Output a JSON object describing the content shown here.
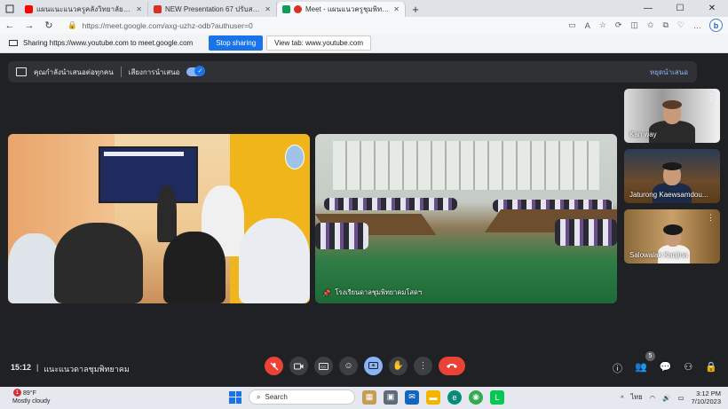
{
  "browser": {
    "tabs": [
      {
        "title": "แผนแนะแนวครูคลังวิทยาลัยสุขสมสุริย...",
        "favicon_color": "#ff0000",
        "active": false
      },
      {
        "title": "NEW Presentation 67 ปรับสาสุด23...",
        "favicon_color": "#d93025",
        "active": false
      },
      {
        "title": "Meet - แผนแนวครูชุมพิทยาคม",
        "favicon_color": "#d93025",
        "active": true
      }
    ],
    "new_tab": "+",
    "url": "https://meet.google.com/axg-uzhz-odb?authuser=0"
  },
  "share_bar": {
    "text": "Sharing https://www.youtube.com to meet.google.com",
    "stop_label": "Stop sharing",
    "view_tab_label": "View tab: www.youtube.com"
  },
  "present_banner": {
    "text": "คุณกำลังนำเสนอต่อทุกคน",
    "audio_label": "เสียงการนำเสนอ",
    "stop_label": "หยุดนำเสนอ"
  },
  "tiles": {
    "right_label": "โรงเรียนดาลชุมพิทยาคมโสดฯ"
  },
  "participants": [
    {
      "name": "Kan way"
    },
    {
      "name": "Jaturong Kaewsamdou..."
    },
    {
      "name": "Salowalak Kanjina"
    }
  ],
  "meeting": {
    "time": "15:12",
    "name": "แนะแนวดาลชุมพิทยาคม",
    "participant_count": "5"
  },
  "taskbar": {
    "temperature": "89°F",
    "weather": "Mostly cloudy",
    "weather_badge": "1",
    "search_placeholder": "Search",
    "language": "ไทย",
    "time": "3:12 PM",
    "date": "7/10/2023"
  },
  "colors": {
    "meet_bg": "#202124",
    "accent_blue": "#1a73e8",
    "end_red": "#ea4335"
  }
}
